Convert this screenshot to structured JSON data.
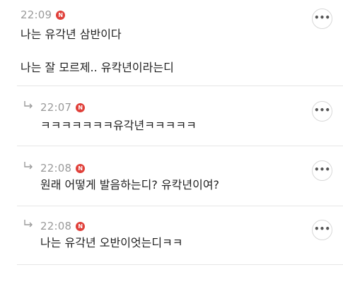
{
  "comments": [
    {
      "time": "22:09",
      "badge": "N",
      "lines": [
        "나는 유각년 삼반이다",
        "나는 잘 모르제.. 유칵년이라는디"
      ]
    }
  ],
  "replies": [
    {
      "time": "22:07",
      "badge": "N",
      "text": "ㅋㅋㅋㅋㅋㅋㅋ유각년ㅋㅋㅋㅋㅋ"
    },
    {
      "time": "22:08",
      "badge": "N",
      "text": "원래 어떻게 발음하는디? 유칵년이여?"
    },
    {
      "time": "22:08",
      "badge": "N",
      "text": "나는 유각년 오반이엇는디ㅋㅋ"
    }
  ],
  "more_button_label": "•••",
  "colors": {
    "badge": "#e0403a",
    "time": "#9a9a9a",
    "divider": "#e6e6e6"
  }
}
